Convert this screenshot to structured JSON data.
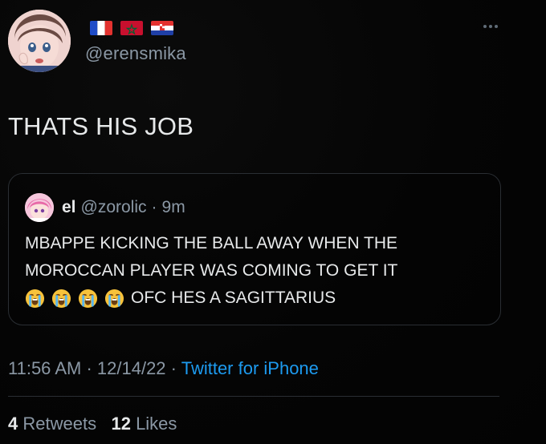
{
  "user": {
    "handle": "@erensmika",
    "flags": [
      "france-flag",
      "morocco-flag",
      "croatia-flag"
    ]
  },
  "tweet": {
    "text": "THATS HIS JOB"
  },
  "quoted_tweet": {
    "name": "el",
    "handle": "@zorolic",
    "separator": "·",
    "time": "9m",
    "line1": "MBAPPE KICKING THE BALL AWAY WHEN THE",
    "line2": "MOROCCAN PLAYER WAS COMING TO GET IT",
    "emojis": [
      "loudly-crying-face-emoji",
      "loudly-crying-face-emoji",
      "loudly-crying-face-emoji",
      "loudly-crying-face-emoji"
    ],
    "line3": "OFC HES A SAGITTARIUS"
  },
  "meta": {
    "time": "11:56 AM",
    "date": "12/14/22",
    "separator": "·",
    "source": "Twitter for iPhone"
  },
  "stats": {
    "retweets_count": "4",
    "retweets_label": "Retweets",
    "likes_count": "12",
    "likes_label": "Likes"
  },
  "colors": {
    "background": "#050505",
    "text": "#e7e9ea",
    "secondary_text": "#8b98a5",
    "link": "#1d9bf0",
    "border": "#2a2e33"
  }
}
